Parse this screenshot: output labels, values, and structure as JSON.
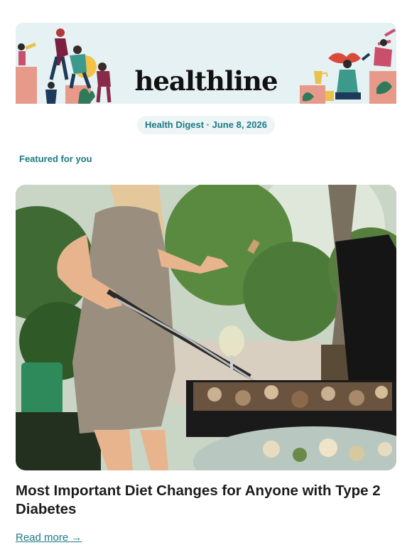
{
  "brand": {
    "logo_text": "healthline"
  },
  "newsletter": {
    "title": "Health Digest · June 8, 2026"
  },
  "section": {
    "label": "Featured for you"
  },
  "article": {
    "headline": "Most Important Diet Changes for Anyone with Type 2 Diabetes",
    "link_text": "Read more →",
    "image_icon": "photo-woman-grilling"
  },
  "colors": {
    "accent": "#1b7a85",
    "banner_bg": "#e6f1f3",
    "pill_bg": "#eef5f6"
  }
}
